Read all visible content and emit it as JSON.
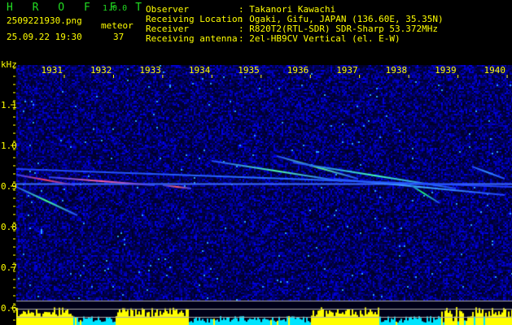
{
  "header": {
    "app_title": "H R O F F T",
    "version": "1.0.0",
    "filename": "2509221930.png",
    "datetime": "25.09.22 19:30",
    "meteor_label": "meteor",
    "meteor_count": "37",
    "info": [
      {
        "label": "Observer",
        "value": ": Takanori Kawachi"
      },
      {
        "label": "Receiving Location",
        "value": ": Ogaki, Gifu, JAPAN (136.60E, 35.35N)"
      },
      {
        "label": "Receiver",
        "value": ": R820T2(RTL-SDR) SDR-Sharp 53.372MHz"
      },
      {
        "label": "Receiving antenna",
        "value": ": 2el-HB9CV Vertical (el. E-W)"
      }
    ]
  },
  "chart_data": {
    "type": "heatmap",
    "ylabel": "kHz",
    "x_ticks": [
      "1931",
      "1932",
      "1933",
      "1934",
      "1935",
      "1936",
      "1937",
      "1938",
      "1939",
      "1940"
    ],
    "y_ticks": [
      "1.1",
      "1.0",
      "0.9",
      "0.8",
      "0.7",
      "0.6"
    ],
    "ylim": [
      0.56,
      1.2
    ],
    "carrier_khz": 0.905,
    "colors": {
      "background": "#000000",
      "noise": "#1a1aa0",
      "text": "#ffff00",
      "title": "#22dd22",
      "histogram": "#ffff00",
      "histogram_low": "#00e5ff"
    }
  }
}
